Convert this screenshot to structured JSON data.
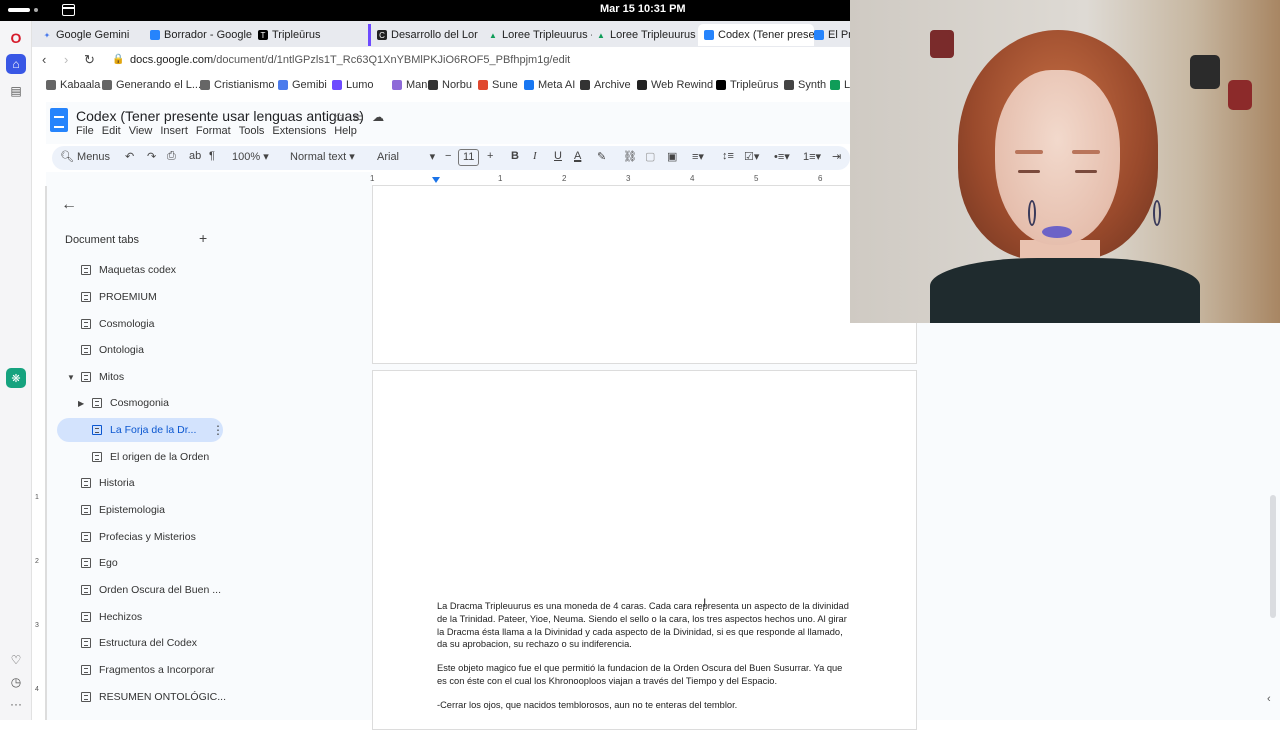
{
  "system_bar": {
    "clock": "Mar 15  10:31 PM"
  },
  "browser": {
    "tabs": [
      {
        "label": "Google Gemini",
        "color": "#4b7bec",
        "glyph": "✦"
      },
      {
        "label": "Borrador - Google D",
        "color": "#2684fc",
        "glyph": ""
      },
      {
        "label": "Tripleūrus",
        "color": "#000000",
        "glyph": "T"
      },
      {
        "label": "Desarrollo del Lore",
        "color": "#222222",
        "glyph": "C"
      },
      {
        "label": "Loree Tripleuurus -",
        "color": "#0f9d58",
        "glyph": "▲"
      },
      {
        "label": "Loree Tripleuurus -",
        "color": "#0f9d58",
        "glyph": "▲"
      },
      {
        "label": "Codex (Tener presen",
        "color": "#2684fc",
        "glyph": ""
      },
      {
        "label": "El Pri",
        "color": "#2684fc",
        "glyph": ""
      }
    ],
    "url_host": "docs.google.com",
    "url_path": "/document/d/1ntlGPzls1T_Rc63Q1XnYBMlPKJiO6ROF5_PBfhpjm1g/edit",
    "bookmarks": [
      {
        "label": "Kabaala",
        "color": "#666666"
      },
      {
        "label": "Generando el L...",
        "color": "#666666"
      },
      {
        "label": "Cristianismo",
        "color": "#666666"
      },
      {
        "label": "Gemibi",
        "color": "#4b7bec"
      },
      {
        "label": "Lumo",
        "color": "#6d4aff"
      },
      {
        "label": "Mana",
        "color": "#8e6ad8"
      },
      {
        "label": "Norbu",
        "color": "#333333"
      },
      {
        "label": "Sune",
        "color": "#e0482f"
      },
      {
        "label": "Meta AI",
        "color": "#1877f2"
      },
      {
        "label": "Archive",
        "color": "#333333"
      },
      {
        "label": "Web Rewind",
        "color": "#222222"
      },
      {
        "label": "Tripleūrus",
        "color": "#000000"
      },
      {
        "label": "Synth",
        "color": "#444444"
      },
      {
        "label": "L",
        "color": "#0f9d58"
      }
    ]
  },
  "docs": {
    "title": "Codex (Tener presente usar lenguas antiguas)",
    "menus": [
      "File",
      "Edit",
      "View",
      "Insert",
      "Format",
      "Tools",
      "Extensions",
      "Help"
    ],
    "toolbar": {
      "search": "Menus",
      "zoom": "100%",
      "style": "Normal text",
      "font": "Arial",
      "font_size": "11"
    },
    "tabs_panel": {
      "header": "Document tabs",
      "items": [
        {
          "label": "Maquetas codex"
        },
        {
          "label": "PROEMIUM"
        },
        {
          "label": "Cosmologia"
        },
        {
          "label": "Ontologia"
        },
        {
          "label": "Mitos"
        },
        {
          "label": "Cosmogonia"
        },
        {
          "label": "La Forja de la Dr..."
        },
        {
          "label": "El origen de la Orden"
        },
        {
          "label": "Historia"
        },
        {
          "label": "Epistemologia"
        },
        {
          "label": "Profecias y Misterios"
        },
        {
          "label": "Ego"
        },
        {
          "label": "Orden Oscura del Buen ..."
        },
        {
          "label": "Hechizos"
        },
        {
          "label": "Estructura del Codex"
        },
        {
          "label": "Fragmentos a Incorporar"
        },
        {
          "label": "RESUMEN ONTOLÓGIC..."
        }
      ]
    },
    "ruler_numbers": [
      "1",
      "1",
      "2",
      "3",
      "4",
      "5",
      "6"
    ],
    "vruler_numbers": [
      "1",
      "2",
      "3",
      "4"
    ],
    "body": {
      "para1": "La Dracma Tripleuurus es una moneda de 4 caras. Cada cara representa un aspecto de la divinidad de la Trinidad. Pateer, Yioe, Neuma. Siendo el sello o la cara, los tres aspectos hechos uno. Al girar la Dracma ésta llama a la Divinidad y cada aspecto de la Divinidad, si es que responde al llamado, da su aprobacion, su rechazo o su indiferencia.",
      "para2": "Este objeto magico fue el que permitió la fundacion de la Orden Oscura del Buen Susurrar. Ya que es con éste con el cual los Khronooploos viajan a través del Tiempo y del Espacio.",
      "para3": "-Cerrar los ojos, que nacidos temblorosos, aun no te enteras del temblor."
    }
  }
}
